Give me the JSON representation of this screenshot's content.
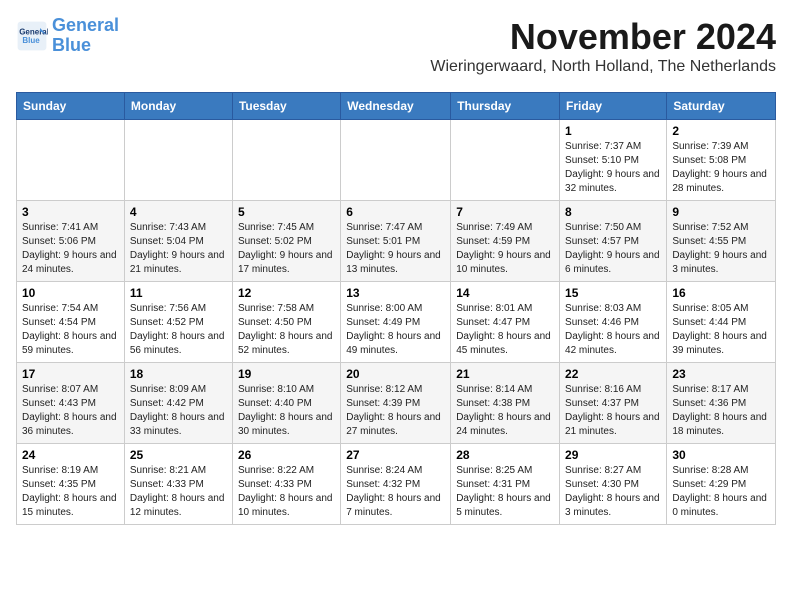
{
  "header": {
    "logo_line1": "General",
    "logo_line2": "Blue",
    "month_title": "November 2024",
    "location": "Wieringerwaard, North Holland, The Netherlands"
  },
  "days_of_week": [
    "Sunday",
    "Monday",
    "Tuesday",
    "Wednesday",
    "Thursday",
    "Friday",
    "Saturday"
  ],
  "weeks": [
    [
      {
        "day": "",
        "info": ""
      },
      {
        "day": "",
        "info": ""
      },
      {
        "day": "",
        "info": ""
      },
      {
        "day": "",
        "info": ""
      },
      {
        "day": "",
        "info": ""
      },
      {
        "day": "1",
        "info": "Sunrise: 7:37 AM\nSunset: 5:10 PM\nDaylight: 9 hours and 32 minutes."
      },
      {
        "day": "2",
        "info": "Sunrise: 7:39 AM\nSunset: 5:08 PM\nDaylight: 9 hours and 28 minutes."
      }
    ],
    [
      {
        "day": "3",
        "info": "Sunrise: 7:41 AM\nSunset: 5:06 PM\nDaylight: 9 hours and 24 minutes."
      },
      {
        "day": "4",
        "info": "Sunrise: 7:43 AM\nSunset: 5:04 PM\nDaylight: 9 hours and 21 minutes."
      },
      {
        "day": "5",
        "info": "Sunrise: 7:45 AM\nSunset: 5:02 PM\nDaylight: 9 hours and 17 minutes."
      },
      {
        "day": "6",
        "info": "Sunrise: 7:47 AM\nSunset: 5:01 PM\nDaylight: 9 hours and 13 minutes."
      },
      {
        "day": "7",
        "info": "Sunrise: 7:49 AM\nSunset: 4:59 PM\nDaylight: 9 hours and 10 minutes."
      },
      {
        "day": "8",
        "info": "Sunrise: 7:50 AM\nSunset: 4:57 PM\nDaylight: 9 hours and 6 minutes."
      },
      {
        "day": "9",
        "info": "Sunrise: 7:52 AM\nSunset: 4:55 PM\nDaylight: 9 hours and 3 minutes."
      }
    ],
    [
      {
        "day": "10",
        "info": "Sunrise: 7:54 AM\nSunset: 4:54 PM\nDaylight: 8 hours and 59 minutes."
      },
      {
        "day": "11",
        "info": "Sunrise: 7:56 AM\nSunset: 4:52 PM\nDaylight: 8 hours and 56 minutes."
      },
      {
        "day": "12",
        "info": "Sunrise: 7:58 AM\nSunset: 4:50 PM\nDaylight: 8 hours and 52 minutes."
      },
      {
        "day": "13",
        "info": "Sunrise: 8:00 AM\nSunset: 4:49 PM\nDaylight: 8 hours and 49 minutes."
      },
      {
        "day": "14",
        "info": "Sunrise: 8:01 AM\nSunset: 4:47 PM\nDaylight: 8 hours and 45 minutes."
      },
      {
        "day": "15",
        "info": "Sunrise: 8:03 AM\nSunset: 4:46 PM\nDaylight: 8 hours and 42 minutes."
      },
      {
        "day": "16",
        "info": "Sunrise: 8:05 AM\nSunset: 4:44 PM\nDaylight: 8 hours and 39 minutes."
      }
    ],
    [
      {
        "day": "17",
        "info": "Sunrise: 8:07 AM\nSunset: 4:43 PM\nDaylight: 8 hours and 36 minutes."
      },
      {
        "day": "18",
        "info": "Sunrise: 8:09 AM\nSunset: 4:42 PM\nDaylight: 8 hours and 33 minutes."
      },
      {
        "day": "19",
        "info": "Sunrise: 8:10 AM\nSunset: 4:40 PM\nDaylight: 8 hours and 30 minutes."
      },
      {
        "day": "20",
        "info": "Sunrise: 8:12 AM\nSunset: 4:39 PM\nDaylight: 8 hours and 27 minutes."
      },
      {
        "day": "21",
        "info": "Sunrise: 8:14 AM\nSunset: 4:38 PM\nDaylight: 8 hours and 24 minutes."
      },
      {
        "day": "22",
        "info": "Sunrise: 8:16 AM\nSunset: 4:37 PM\nDaylight: 8 hours and 21 minutes."
      },
      {
        "day": "23",
        "info": "Sunrise: 8:17 AM\nSunset: 4:36 PM\nDaylight: 8 hours and 18 minutes."
      }
    ],
    [
      {
        "day": "24",
        "info": "Sunrise: 8:19 AM\nSunset: 4:35 PM\nDaylight: 8 hours and 15 minutes."
      },
      {
        "day": "25",
        "info": "Sunrise: 8:21 AM\nSunset: 4:33 PM\nDaylight: 8 hours and 12 minutes."
      },
      {
        "day": "26",
        "info": "Sunrise: 8:22 AM\nSunset: 4:33 PM\nDaylight: 8 hours and 10 minutes."
      },
      {
        "day": "27",
        "info": "Sunrise: 8:24 AM\nSunset: 4:32 PM\nDaylight: 8 hours and 7 minutes."
      },
      {
        "day": "28",
        "info": "Sunrise: 8:25 AM\nSunset: 4:31 PM\nDaylight: 8 hours and 5 minutes."
      },
      {
        "day": "29",
        "info": "Sunrise: 8:27 AM\nSunset: 4:30 PM\nDaylight: 8 hours and 3 minutes."
      },
      {
        "day": "30",
        "info": "Sunrise: 8:28 AM\nSunset: 4:29 PM\nDaylight: 8 hours and 0 minutes."
      }
    ]
  ]
}
